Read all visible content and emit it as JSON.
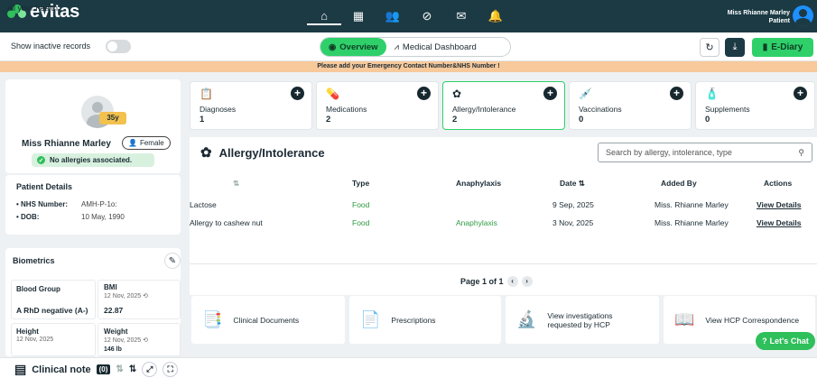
{
  "brand": {
    "name": "evitas",
    "tagline": "all your health"
  },
  "nav": {
    "items": [
      "⌂",
      "▦",
      "👥",
      "⊘",
      "✉",
      "🔔"
    ]
  },
  "user": {
    "name": "Miss Rhianne Marley",
    "role": "Patient"
  },
  "toolbar": {
    "inactive_label": "Show inactive records",
    "tab_overview": "Overview",
    "tab_medical": "Medical Dashboard",
    "refresh": "↻",
    "download": "⤓",
    "ediary": "E-Diary"
  },
  "alert": "Please add your Emergency Contact Number&NHS Number !",
  "patient": {
    "age": "35y",
    "name": "Miss Rhianne Marley",
    "gender": "Female",
    "allergy_status": "No allergies associated.",
    "details_title": "Patient Details",
    "nhs_label": "• NHS Number:",
    "nhs_value": "AMH-P-1o:",
    "dob_label": "• DOB:",
    "dob_value": "10 May, 1990"
  },
  "biometrics": {
    "title": "Biometrics",
    "cells": [
      {
        "title": "Blood Group",
        "sub": "",
        "value": "A RhD negative (A-)"
      },
      {
        "title": "BMI",
        "sub": "12 Nov, 2025 ⟲",
        "value": "22.87"
      },
      {
        "title": "Height",
        "sub": "12 Nov, 2025",
        "value": ""
      },
      {
        "title": "Weight",
        "sub": "12 Nov, 2025 ⟲",
        "value": "146 lb"
      }
    ]
  },
  "tiles": [
    {
      "icon": "📋",
      "label": "Diagnoses",
      "count": "1"
    },
    {
      "icon": "💊",
      "label": "Medications",
      "count": "2"
    },
    {
      "icon": "✿",
      "label": "Allergy/Intolerance",
      "count": "2"
    },
    {
      "icon": "💉",
      "label": "Vaccinations",
      "count": "0"
    },
    {
      "icon": "🧴",
      "label": "Supplements",
      "count": "0"
    }
  ],
  "section": {
    "title": "Allergy/Intolerance",
    "search_placeholder": "Search by allergy, intolerance, type"
  },
  "table": {
    "headers": [
      "⇅",
      "Type",
      "Anaphylaxis",
      "Date ⇅",
      "Added By",
      "Actions"
    ],
    "rows": [
      {
        "name": "Lactose",
        "type": "Food",
        "anaphylaxis": "",
        "date": "9 Sep, 2025",
        "added_by": "Miss. Rhianne Marley",
        "action": "View Details"
      },
      {
        "name": "Allergy to cashew nut",
        "type": "Food",
        "anaphylaxis": "Anaphylaxis",
        "date": "3 Nov, 2025",
        "added_by": "Miss. Rhianne Marley",
        "action": "View Details"
      }
    ]
  },
  "pager": {
    "text": "Page 1 of 1",
    "prev": "‹",
    "next": "›"
  },
  "quick": [
    {
      "icon": "📑",
      "label": "Clinical Documents"
    },
    {
      "icon": "📄",
      "label": "Prescriptions"
    },
    {
      "icon": "🔬",
      "label": "View investigations requested by HCP"
    },
    {
      "icon": "📖",
      "label": "View HCP Correspondence"
    }
  ],
  "chat": "Let's Chat",
  "clinical_note": {
    "label": "Clinical note",
    "count": "(0)"
  }
}
